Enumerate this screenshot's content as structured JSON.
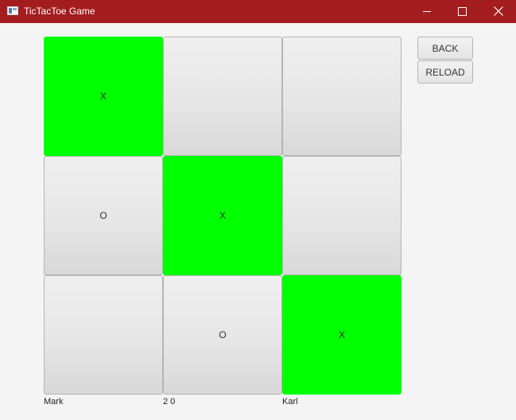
{
  "window": {
    "title": "TicTacToe Game"
  },
  "board": {
    "cells": [
      {
        "mark": "X",
        "highlighted": true
      },
      {
        "mark": "",
        "highlighted": false
      },
      {
        "mark": "",
        "highlighted": false
      },
      {
        "mark": "O",
        "highlighted": false
      },
      {
        "mark": "X",
        "highlighted": true
      },
      {
        "mark": "",
        "highlighted": false
      },
      {
        "mark": "",
        "highlighted": false
      },
      {
        "mark": "O",
        "highlighted": false
      },
      {
        "mark": "X",
        "highlighted": true
      }
    ]
  },
  "controls": {
    "back_label": "BACK",
    "reload_label": "RELOAD"
  },
  "footer": {
    "player1": "Mark",
    "score": "2 0",
    "player2": "Karl"
  },
  "colors": {
    "title_bar": "#a31d1f",
    "win_highlight": "#00ff00",
    "background": "#f4f4f4"
  }
}
